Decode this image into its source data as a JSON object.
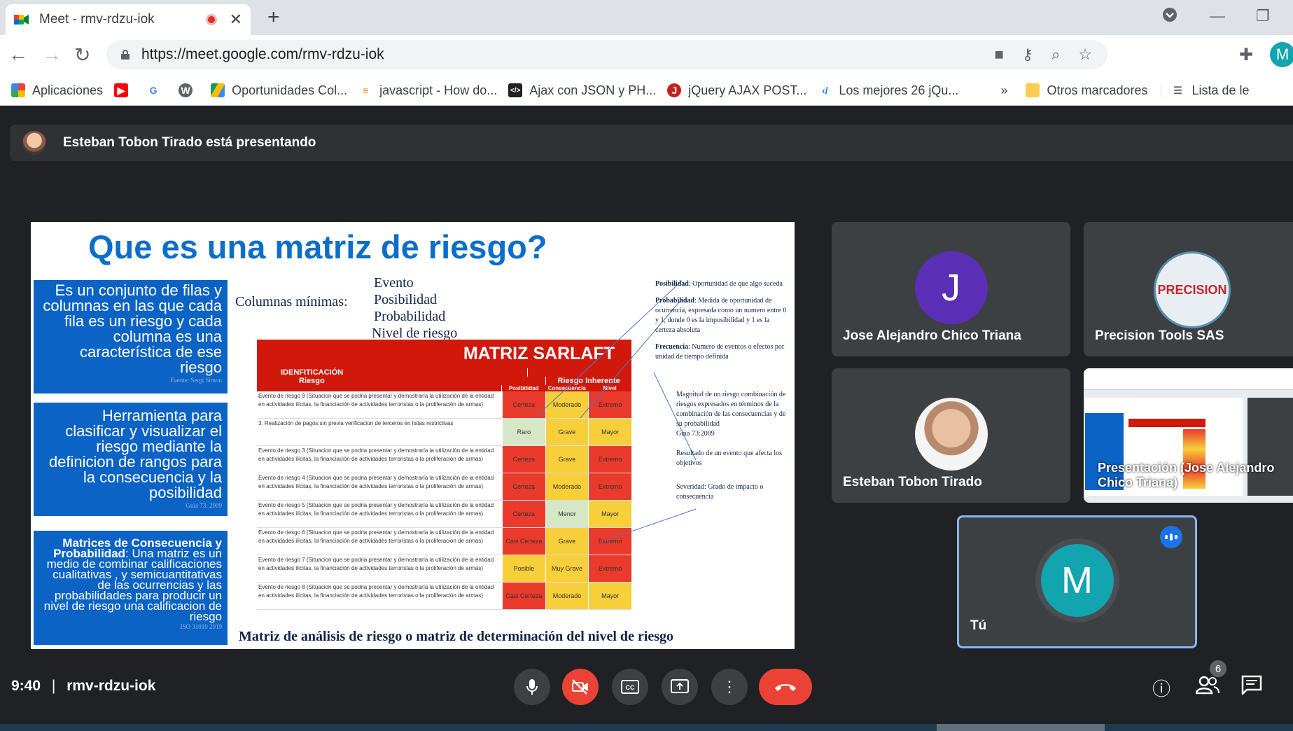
{
  "browser": {
    "tab_title": "Meet - rmv-rdzu-iok",
    "new_tab_symbol": "+",
    "url": "https://meet.google.com/rmv-rdzu-iok",
    "profile_initial": "M",
    "bookmarks": [
      "Aplicaciones",
      "Oportunidades Col...",
      "javascript - How do...",
      "Ajax con JSON y PH...",
      "jQuery AJAX POST...",
      "Los mejores 26 jQu..."
    ],
    "more_bookmarks": "»",
    "other_bookmarks": "Otros marcadores",
    "reading_list": "Lista de le"
  },
  "meet": {
    "presenting_text": "Esteban Tobon Tirado está presentando",
    "time": "9:40",
    "meeting_code": "rmv-rdzu-iok",
    "participants_count": "6",
    "tiles": [
      {
        "name": "Jose Alejandro Chico Triana",
        "initial": "J",
        "color": "#5b2fb5"
      },
      {
        "name": "Precision Tools SAS",
        "logo_text": "PRECISION"
      },
      {
        "name": "Esteban Tobon Tirado"
      },
      {
        "name": "Presentación (Jose Alejandro Chico Triana)"
      },
      {
        "name": "Tú",
        "initial": "M",
        "color": "#12a4af"
      }
    ]
  },
  "slide": {
    "title": "Que es una matriz de riesgo?",
    "box1": "Es un conjunto de filas y columnas en las que cada fila es un riesgo y cada columna es una característica de ese riesgo",
    "box1_src": "Fuente: Sergi Simon",
    "box2": "Herramienta para clasificar y visualizar el riesgo mediante la definicion de rangos para la consecuencia  y la posibilidad",
    "box2_src": "Guía 73: 2009",
    "box3_bold": "Matrices de Consecuencia y Probabilidad",
    "box3": ": Una matriz es un medio de combinar calificaciones cualitativas , y semicuantitativas de las ocurrencias y las probabilidades para producir un nivel de riesgo una calificacion de riesgo",
    "box3_src": "ISO 31010 2019",
    "columns_label": "Columnas mínimas:",
    "columns": [
      "Evento",
      "Posibilidad",
      "Probabilidad",
      "Nivel de riesgo"
    ],
    "matrix_title": "MATRIZ SARLAFT",
    "head_ident": "IDENFITICACIÓN",
    "head_riesgo": "Riesgo",
    "head_inherente": "Riesgo Inherente",
    "head_cols": [
      "Posibilidad",
      "Consecuencia",
      "Nivel"
    ],
    "rows": [
      {
        "desc": "Evento de riesgo 9 (Situacion que se podria presentar y demostraría la utilización de la entidad en actividades ilícitas, la financiación de actividades terroristas o la proliferación de armas)",
        "p": "Certeza",
        "c": "Moderado",
        "n": "Extremo"
      },
      {
        "desc": "3. Realización de pagos sin previa verificacion de terceros en listas restrictivas",
        "p": "Raro",
        "c": "Grave",
        "n": "Mayor"
      },
      {
        "desc": "Evento de riesgo 3 (Situacion que se podria presentar y demostraría la utilización de la entidad en actividades ilícitas, la financiación de actividades terroristas o la proliferación de armas)",
        "p": "Certeza",
        "c": "Grave",
        "n": "Extremo"
      },
      {
        "desc": "Evento de riesgo 4 (Situacion que se podria presentar y demostraría la utilización de la entidad en actividades ilícitas, la financiación de actividades terroristas o la proliferación de armas)",
        "p": "Certeza",
        "c": "Moderado",
        "n": "Extremo"
      },
      {
        "desc": "Evento de riesgo 5 (Situacion que se podria presentar y demostraría la utilización de la entidad en actividades ilícitas, la financiación de actividades terroristas o la proliferación de armas)",
        "p": "Certeza",
        "c": "Menor",
        "n": "Mayor"
      },
      {
        "desc": "Evento de riesgo 6 (Situacion que se podria presentar y demostraría la utilización de la entidad en actividades ilícitas, la financiación de actividades terroristas o la proliferación de armas)",
        "p": "Casi Certeza",
        "c": "Grave",
        "n": "Extremo"
      },
      {
        "desc": "Evento de riesgo 7 (Situacion que se podria presentar y demostraría la utilización de la entidad en actividades ilícitas, la financiación de actividades terroristas o la proliferación de armas)",
        "p": "Posible",
        "c": "Muy Grave",
        "n": "Extremo"
      },
      {
        "desc": "Evento de riesgo 8 (Situacion que se podria presentar y demostraría la utilización de la entidad en actividades ilícitas, la financiación de actividades terroristas o la proliferación de armas)",
        "p": "Casi Certeza",
        "c": "Moderado",
        "n": "Mayor"
      }
    ],
    "note1_bold": "Posibilidad",
    "note1": ": Oportunidad de que algo suceda",
    "note2_bold": "Probabilidad",
    "note2": ": Medida de oportunidad de ocurrencia, expresada como un numero entre 0 y 1, donde 0 es la imposibilidad y 1 es la certeza absoluta",
    "note3_bold": "Frecuencia",
    "note3": ": Numero de eventos o efectos por unidad de tiempo definida",
    "note4": "Magnitud de un riesgo combinación de riesgos expresados en términos de la combinación de las consecuencias y de su probabilidad",
    "note4_src": "Guía 73:2009",
    "note5": "Resultado de un evento que afecta los objetivos",
    "note6": "Severidad:  Grado de impacto o consecuencia",
    "footer": "Matriz de análisis de riesgo o matriz de determinación del nivel de riesgo"
  },
  "colors": {
    "meet_bg": "#202124",
    "tile_bg": "#3c4043",
    "danger": "#ea4335",
    "slide_blue": "#0b63c6",
    "matrix_red": "#d0180b",
    "cell_red": "#ea3a2c",
    "cell_yellow": "#f7cf3a",
    "cell_green": "#d6e7c6"
  }
}
